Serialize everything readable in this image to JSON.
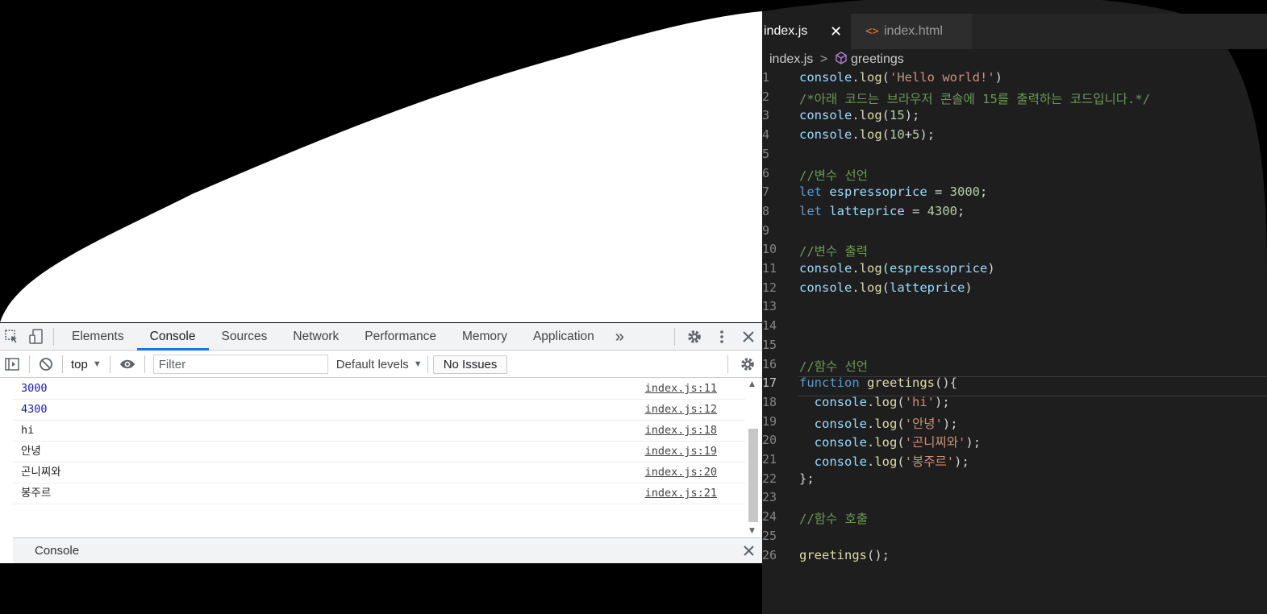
{
  "devtools": {
    "tabs": [
      "Elements",
      "Console",
      "Sources",
      "Network",
      "Performance",
      "Memory",
      "Application"
    ],
    "active_tab": "Console",
    "more_tabs_label": "»",
    "context": "top",
    "filter_placeholder": "Filter",
    "levels": "Default levels",
    "issues": "No Issues",
    "messages": [
      {
        "text": "3000",
        "source": "index.js:11",
        "type": "number"
      },
      {
        "text": "4300",
        "source": "index.js:12",
        "type": "number"
      },
      {
        "text": "hi",
        "source": "index.js:18",
        "type": "string"
      },
      {
        "text": "안녕",
        "source": "index.js:19",
        "type": "string"
      },
      {
        "text": "곤니찌와",
        "source": "index.js:20",
        "type": "string"
      },
      {
        "text": "봉주르",
        "source": "index.js:21",
        "type": "string"
      }
    ],
    "drawer_label": "Console"
  },
  "editor": {
    "tabs": [
      {
        "label": "index.js",
        "active": true
      },
      {
        "label": "index.html",
        "active": false
      }
    ],
    "breadcrumb": {
      "file": "index.js",
      "symbol": "greetings"
    },
    "lines": [
      {
        "n": "1",
        "code": [
          [
            "console",
            "var"
          ],
          [
            ".",
            "p"
          ],
          [
            "log",
            "fn"
          ],
          [
            "(",
            "p"
          ],
          [
            "'Hello world!'",
            "str"
          ],
          [
            ")",
            "p"
          ]
        ]
      },
      {
        "n": "2",
        "code": [
          [
            "/*아래 코드는 브라우저 콘솔에 15를 출력하는 코드입니다.*/",
            "com"
          ]
        ]
      },
      {
        "n": "3",
        "code": [
          [
            "console",
            "var"
          ],
          [
            ".",
            "p"
          ],
          [
            "log",
            "fn"
          ],
          [
            "(",
            "p"
          ],
          [
            "15",
            "num"
          ],
          [
            ");",
            "p"
          ]
        ]
      },
      {
        "n": "4",
        "code": [
          [
            "console",
            "var"
          ],
          [
            ".",
            "p"
          ],
          [
            "log",
            "fn"
          ],
          [
            "(",
            "p"
          ],
          [
            "10",
            "num"
          ],
          [
            "+",
            "p"
          ],
          [
            "5",
            "num"
          ],
          [
            ");",
            "p"
          ]
        ]
      },
      {
        "n": "5",
        "code": []
      },
      {
        "n": "6",
        "code": [
          [
            "//변수 선언",
            "com"
          ]
        ]
      },
      {
        "n": "7",
        "code": [
          [
            "let",
            "kw"
          ],
          [
            " ",
            "p"
          ],
          [
            "espressoprice",
            "var"
          ],
          [
            " = ",
            "p"
          ],
          [
            "3000",
            "num"
          ],
          [
            ";",
            "p"
          ]
        ]
      },
      {
        "n": "8",
        "code": [
          [
            "let",
            "kw"
          ],
          [
            " ",
            "p"
          ],
          [
            "latteprice",
            "var"
          ],
          [
            " = ",
            "p"
          ],
          [
            "4300",
            "num"
          ],
          [
            ";",
            "p"
          ]
        ]
      },
      {
        "n": "9",
        "code": []
      },
      {
        "n": "10",
        "code": [
          [
            "//변수 출력",
            "com"
          ]
        ]
      },
      {
        "n": "11",
        "code": [
          [
            "console",
            "var"
          ],
          [
            ".",
            "p"
          ],
          [
            "log",
            "fn"
          ],
          [
            "(",
            "p"
          ],
          [
            "espressoprice",
            "var"
          ],
          [
            ")",
            "p"
          ]
        ]
      },
      {
        "n": "12",
        "code": [
          [
            "console",
            "var"
          ],
          [
            ".",
            "p"
          ],
          [
            "log",
            "fn"
          ],
          [
            "(",
            "p"
          ],
          [
            "latteprice",
            "var"
          ],
          [
            ")",
            "p"
          ]
        ]
      },
      {
        "n": "13",
        "code": []
      },
      {
        "n": "14",
        "code": []
      },
      {
        "n": "15",
        "code": []
      },
      {
        "n": "16",
        "code": [
          [
            "//함수 선언",
            "com"
          ]
        ]
      },
      {
        "n": "17",
        "code": [
          [
            "function",
            "kw"
          ],
          [
            " ",
            "p"
          ],
          [
            "greetings",
            "fn"
          ],
          [
            "(){",
            "p"
          ]
        ]
      },
      {
        "n": "18",
        "code": [
          [
            "  console",
            "var"
          ],
          [
            ".",
            "p"
          ],
          [
            "log",
            "fn"
          ],
          [
            "(",
            "p"
          ],
          [
            "'hi'",
            "str"
          ],
          [
            ");",
            "p"
          ]
        ]
      },
      {
        "n": "19",
        "code": [
          [
            "  console",
            "var"
          ],
          [
            ".",
            "p"
          ],
          [
            "log",
            "fn"
          ],
          [
            "(",
            "p"
          ],
          [
            "'안녕'",
            "str"
          ],
          [
            ");",
            "p"
          ]
        ]
      },
      {
        "n": "20",
        "code": [
          [
            "  console",
            "var"
          ],
          [
            ".",
            "p"
          ],
          [
            "log",
            "fn"
          ],
          [
            "(",
            "p"
          ],
          [
            "'곤니찌와'",
            "str"
          ],
          [
            ");",
            "p"
          ]
        ]
      },
      {
        "n": "21",
        "code": [
          [
            "  console",
            "var"
          ],
          [
            ".",
            "p"
          ],
          [
            "log",
            "fn"
          ],
          [
            "(",
            "p"
          ],
          [
            "'봉주르'",
            "str"
          ],
          [
            ");",
            "p"
          ]
        ]
      },
      {
        "n": "22",
        "code": [
          [
            "};",
            "p"
          ]
        ]
      },
      {
        "n": "23",
        "code": []
      },
      {
        "n": "24",
        "code": [
          [
            "//함수 호출",
            "com"
          ]
        ]
      },
      {
        "n": "25",
        "code": []
      },
      {
        "n": "26",
        "code": [
          [
            "greetings",
            "fn"
          ],
          [
            "();",
            "p"
          ]
        ]
      }
    ]
  },
  "colors": {
    "editor_bg": "#1e1e1e",
    "accent": "#1a73e8",
    "comment": "#6a9955",
    "string": "#ce9178",
    "number": "#b5cea8",
    "keyword": "#569cd6",
    "function": "#dcdcaa",
    "variable": "#9cdcfe"
  }
}
